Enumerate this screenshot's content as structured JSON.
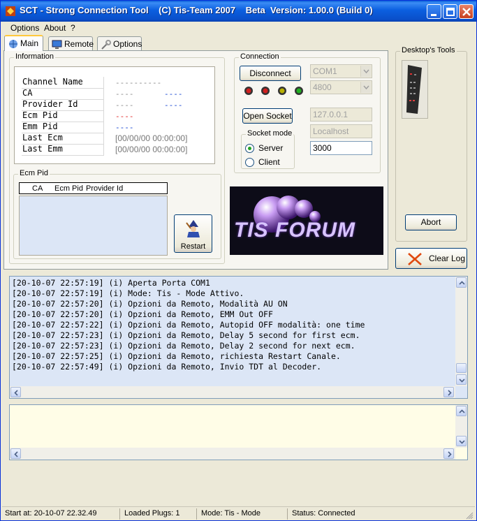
{
  "window": {
    "title": "SCT - Strong Connection Tool    (C) Tis-Team 2007    Beta  Version: 1.00.0 (Build 0)"
  },
  "menu": {
    "items": [
      {
        "label": "Options"
      },
      {
        "label": "About"
      },
      {
        "label": "?"
      }
    ]
  },
  "tabs": [
    {
      "label": "Main",
      "icon": "network-icon"
    },
    {
      "label": "Remote",
      "icon": "monitor-icon"
    },
    {
      "label": "Options",
      "icon": "tools-icon"
    }
  ],
  "information": {
    "legend": "Information",
    "rows": [
      {
        "label": "Channel Name",
        "value1": "----------",
        "value2": ""
      },
      {
        "label": "CA",
        "value1": "----",
        "value2": "----"
      },
      {
        "label": "Provider Id",
        "value1": "----",
        "value2": "----"
      },
      {
        "label": "Ecm Pid",
        "value1": "----",
        "value2": ""
      },
      {
        "label": "Emm Pid",
        "value1": "----",
        "value2": ""
      },
      {
        "label": "Last Ecm",
        "value1": "[00/00/00 00:00:00]",
        "value2": ""
      },
      {
        "label": "Last Emm",
        "value1": "[00/00/00 00:00:00]",
        "value2": ""
      }
    ]
  },
  "ecm_pid": {
    "legend": "Ecm Pid",
    "columns": [
      "CA",
      "Ecm Pid",
      "Provider Id"
    ],
    "restart_label": "Restart"
  },
  "connection": {
    "legend": "Connection",
    "disconnect_label": "Disconnect",
    "port_value": "COM1",
    "baud_value": "4800",
    "open_socket_label": "Open Socket",
    "ip_value": "127.0.0.1",
    "host_value": "Localhost",
    "port_number": "3000",
    "leds": [
      {
        "name": "led-1",
        "color": "#d02020"
      },
      {
        "name": "led-2",
        "color": "#d02020"
      },
      {
        "name": "led-3",
        "color": "#b8b000"
      },
      {
        "name": "led-4",
        "color": "#20b020"
      }
    ],
    "socket_mode": {
      "legend": "Socket mode",
      "server_label": "Server",
      "client_label": "Client",
      "selected": "Server"
    }
  },
  "logo": {
    "text": "TIS FORUM"
  },
  "desktop_tools": {
    "legend": "Desktop's Tools",
    "abort_label": "Abort",
    "clear_log_label": "Clear Log"
  },
  "log": {
    "lines": [
      "[20-10-07 22:57:19] (i) Aperta Porta COM1",
      "[20-10-07 22:57:19] (i) Mode: Tis - Mode Attivo.",
      "[20-10-07 22:57:20] (i) Opzioni da Remoto, Modalità AU ON",
      "[20-10-07 22:57:20] (i) Opzioni da Remoto, EMM Out OFF",
      "[20-10-07 22:57:22] (i) Opzioni da Remoto, Autopid OFF modalità: one time",
      "[20-10-07 22:57:23] (i) Opzioni da Remoto, Delay 5 second for first ecm.",
      "[20-10-07 22:57:23] (i) Opzioni da Remoto, Delay 2 second for next ecm.",
      "[20-10-07 22:57:25] (i) Opzioni da Remoto, richiesta Restart Canale.",
      "[20-10-07 22:57:49] (i) Opzioni da Remoto, Invio TDT al Decoder."
    ]
  },
  "statusbar": {
    "start": "Start at: 20-10-07 22.32.49",
    "plugs": "Loaded Plugs: 1",
    "mode": "Mode: Tis - Mode",
    "status": "Status: Connected"
  },
  "colors": {
    "titlebar": "#0a5fd8",
    "log_bg": "#dce6f6",
    "input_bg": "#fffde7",
    "logo_text": "#c8a8ff"
  }
}
